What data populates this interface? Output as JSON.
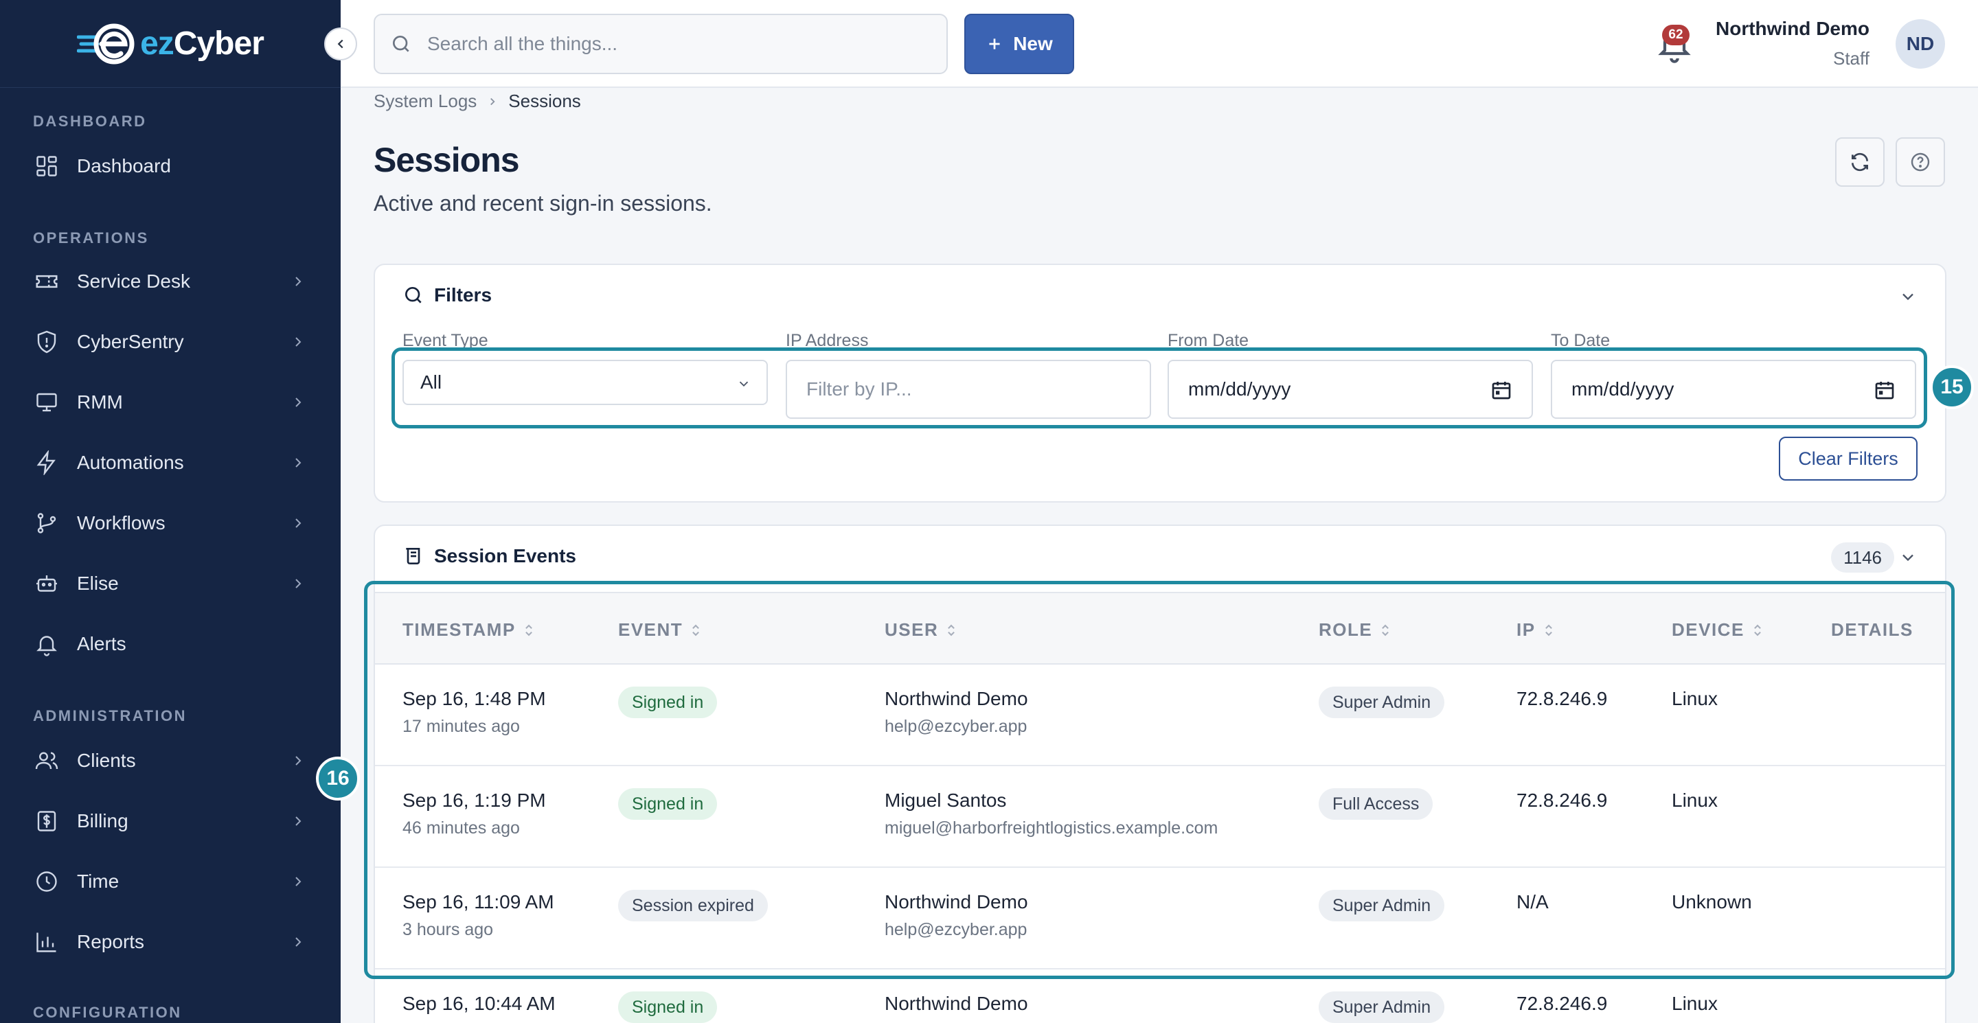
{
  "brand": {
    "prefix": "ez",
    "name": "Cyber"
  },
  "sidebar": {
    "sections": [
      {
        "label": "DASHBOARD"
      },
      {
        "label": "OPERATIONS"
      },
      {
        "label": "ADMINISTRATION"
      },
      {
        "label": "CONFIGURATION"
      }
    ],
    "items": [
      {
        "label": "Dashboard",
        "icon": "grid-icon"
      },
      {
        "label": "Service Desk",
        "icon": "ticket-icon"
      },
      {
        "label": "CyberSentry",
        "icon": "shield-icon"
      },
      {
        "label": "RMM",
        "icon": "monitor-icon"
      },
      {
        "label": "Automations",
        "icon": "bolt-icon"
      },
      {
        "label": "Workflows",
        "icon": "branch-icon"
      },
      {
        "label": "Elise",
        "icon": "robot-icon"
      },
      {
        "label": "Alerts",
        "icon": "bell-icon"
      },
      {
        "label": "Clients",
        "icon": "users-icon"
      },
      {
        "label": "Billing",
        "icon": "dollar-icon"
      },
      {
        "label": "Time",
        "icon": "clock-icon"
      },
      {
        "label": "Reports",
        "icon": "bar-chart-icon"
      }
    ]
  },
  "topbar": {
    "search_placeholder": "Search all the things...",
    "new_label": "New",
    "notification_count": "62",
    "user_name": "Northwind Demo",
    "user_role": "Staff",
    "avatar_initials": "ND"
  },
  "breadcrumb": {
    "parent": "System Logs",
    "current": "Sessions"
  },
  "page": {
    "title": "Sessions",
    "subtitle": "Active and recent sign-in sessions."
  },
  "filters": {
    "title": "Filters",
    "event_type_label": "Event Type",
    "event_type_value": "All",
    "ip_label": "IP Address",
    "ip_placeholder": "Filter by IP...",
    "from_label": "From Date",
    "from_placeholder": "mm/dd/yyyy",
    "to_label": "To Date",
    "to_placeholder": "mm/dd/yyyy",
    "clear_label": "Clear Filters"
  },
  "markers": {
    "filters": "15",
    "table": "16"
  },
  "events": {
    "title": "Session Events",
    "count": "1146",
    "columns": [
      "TIMESTAMP",
      "EVENT",
      "USER",
      "ROLE",
      "IP",
      "DEVICE",
      "DETAILS"
    ],
    "rows": [
      {
        "time": "Sep 16, 1:48 PM",
        "ago": "17 minutes ago",
        "event": "Signed in",
        "event_type": "green",
        "user": "Northwind Demo",
        "email": "help@ezcyber.app",
        "role": "Super Admin",
        "ip": "72.8.246.9",
        "device": "Linux"
      },
      {
        "time": "Sep 16, 1:19 PM",
        "ago": "46 minutes ago",
        "event": "Signed in",
        "event_type": "green",
        "user": "Miguel Santos",
        "email": "miguel@harborfreightlogistics.example.com",
        "role": "Full Access",
        "ip": "72.8.246.9",
        "device": "Linux"
      },
      {
        "time": "Sep 16, 11:09 AM",
        "ago": "3 hours ago",
        "event": "Session expired",
        "event_type": "gray",
        "user": "Northwind Demo",
        "email": "help@ezcyber.app",
        "role": "Super Admin",
        "ip": "N/A",
        "device": "Unknown"
      },
      {
        "time": "Sep 16, 10:44 AM",
        "ago": "",
        "event": "Signed in",
        "event_type": "green",
        "user": "Northwind Demo",
        "email": "",
        "role": "Super Admin",
        "ip": "72.8.246.9",
        "device": "Linux"
      }
    ]
  }
}
